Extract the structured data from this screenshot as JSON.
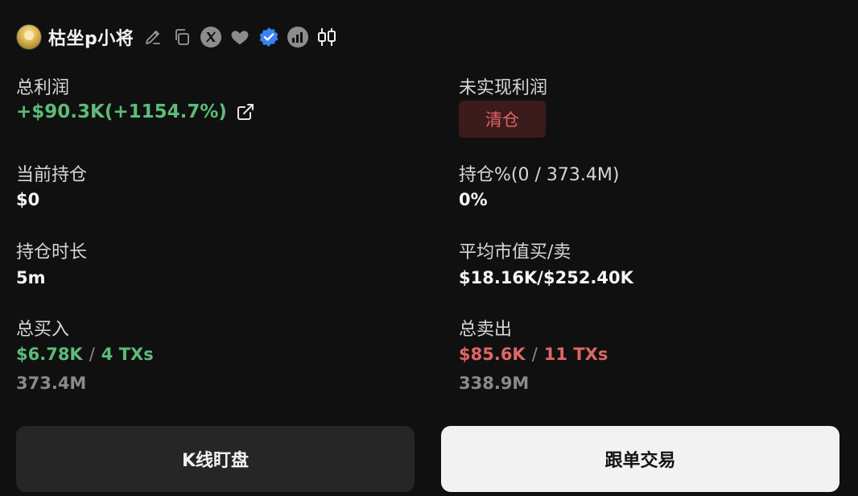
{
  "header": {
    "username": "枯坐p小将",
    "icons": [
      "avatar",
      "edit-icon",
      "copy-icon",
      "x-icon",
      "heart-icon",
      "verified-icon",
      "chart-icon",
      "candlestick-icon"
    ]
  },
  "stats": {
    "total_profit": {
      "label": "总利润",
      "value": "+$90.3K(+1154.7%)"
    },
    "unrealized_profit": {
      "label": "未实现利润",
      "badge": "清仓"
    },
    "current_position": {
      "label": "当前持仓",
      "value": "$0"
    },
    "position_pct": {
      "label": "持仓%(0 / 373.4M)",
      "value": "0%"
    },
    "holding_duration": {
      "label": "持仓时长",
      "value": "5m"
    },
    "avg_market_cap": {
      "label": "平均市值买/卖",
      "value": "$18.16K/$252.40K"
    },
    "total_buy": {
      "label": "总买入",
      "amount": "$6.78K",
      "separator": "/",
      "txs": "4 TXs",
      "tokens": "373.4M"
    },
    "total_sell": {
      "label": "总卖出",
      "amount": "$85.6K",
      "separator": "/",
      "txs": "11 TXs",
      "tokens": "338.9M"
    }
  },
  "actions": {
    "kline_label": "K线盯盘",
    "copy_trade_label": "跟单交易"
  },
  "colors": {
    "background": "#101010",
    "positive": "#5dbb79",
    "negative": "#e06666",
    "badge_bg": "#3b1b1c",
    "verified": "#3b82f6"
  }
}
